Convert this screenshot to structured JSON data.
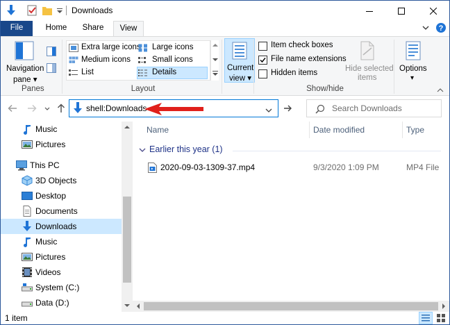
{
  "window": {
    "title": "Downloads",
    "minimize": "—",
    "maximize": "☐",
    "close": "✕"
  },
  "ribbon_tabs": [
    "File",
    "Home",
    "Share",
    "View"
  ],
  "ribbon": {
    "panes": {
      "navigation_pane_line1": "Navigation",
      "navigation_pane_line2": "pane ▾",
      "group": "Panes"
    },
    "layout": {
      "options": [
        "Extra large icons",
        "Large icons",
        "Medium icons",
        "Small icons",
        "List",
        "Details"
      ],
      "selected": "Details",
      "group": "Layout"
    },
    "current_view": {
      "line1": "Current",
      "line2": "view ▾"
    },
    "show_hide": {
      "item_check_boxes": "Item check boxes",
      "item_check_boxes_checked": false,
      "file_name_extensions": "File name extensions",
      "file_name_extensions_checked": true,
      "hidden_items": "Hidden items",
      "hidden_items_checked": false,
      "hide_selected_line1": "Hide selected",
      "hide_selected_line2": "items",
      "group": "Show/hide"
    },
    "options": {
      "label": "Options",
      "arrow": "▾"
    }
  },
  "address_bar": {
    "value": "shell:Downloads"
  },
  "search": {
    "placeholder": "Search Downloads"
  },
  "nav_pane": {
    "items": [
      {
        "label": "Music",
        "icon": "music-icon"
      },
      {
        "label": "Pictures",
        "icon": "pictures-icon"
      },
      {
        "label": "This PC",
        "icon": "this-pc-icon"
      },
      {
        "label": "3D Objects",
        "icon": "3d-objects-icon"
      },
      {
        "label": "Desktop",
        "icon": "desktop-icon"
      },
      {
        "label": "Documents",
        "icon": "documents-icon"
      },
      {
        "label": "Downloads",
        "icon": "downloads-icon",
        "selected": true
      },
      {
        "label": "Music",
        "icon": "music-icon"
      },
      {
        "label": "Pictures",
        "icon": "pictures-icon"
      },
      {
        "label": "Videos",
        "icon": "videos-icon"
      },
      {
        "label": "System (C:)",
        "icon": "system-drive-icon"
      },
      {
        "label": "Data (D:)",
        "icon": "data-drive-icon"
      }
    ]
  },
  "file_list": {
    "columns": [
      "Name",
      "Date modified",
      "Type"
    ],
    "group": "Earlier this year (1)",
    "rows": [
      {
        "name": "2020-09-03-1309-37.mp4",
        "date_modified": "9/3/2020 1:09 PM",
        "type": "MP4 File"
      }
    ]
  },
  "status_bar": {
    "item_count": "1 item"
  },
  "colors": {
    "accent": "#0078d7",
    "file_tab": "#19478a",
    "annotation_arrow": "#e0201b",
    "group_header": "#1e3287",
    "selection": "#cce8ff"
  }
}
